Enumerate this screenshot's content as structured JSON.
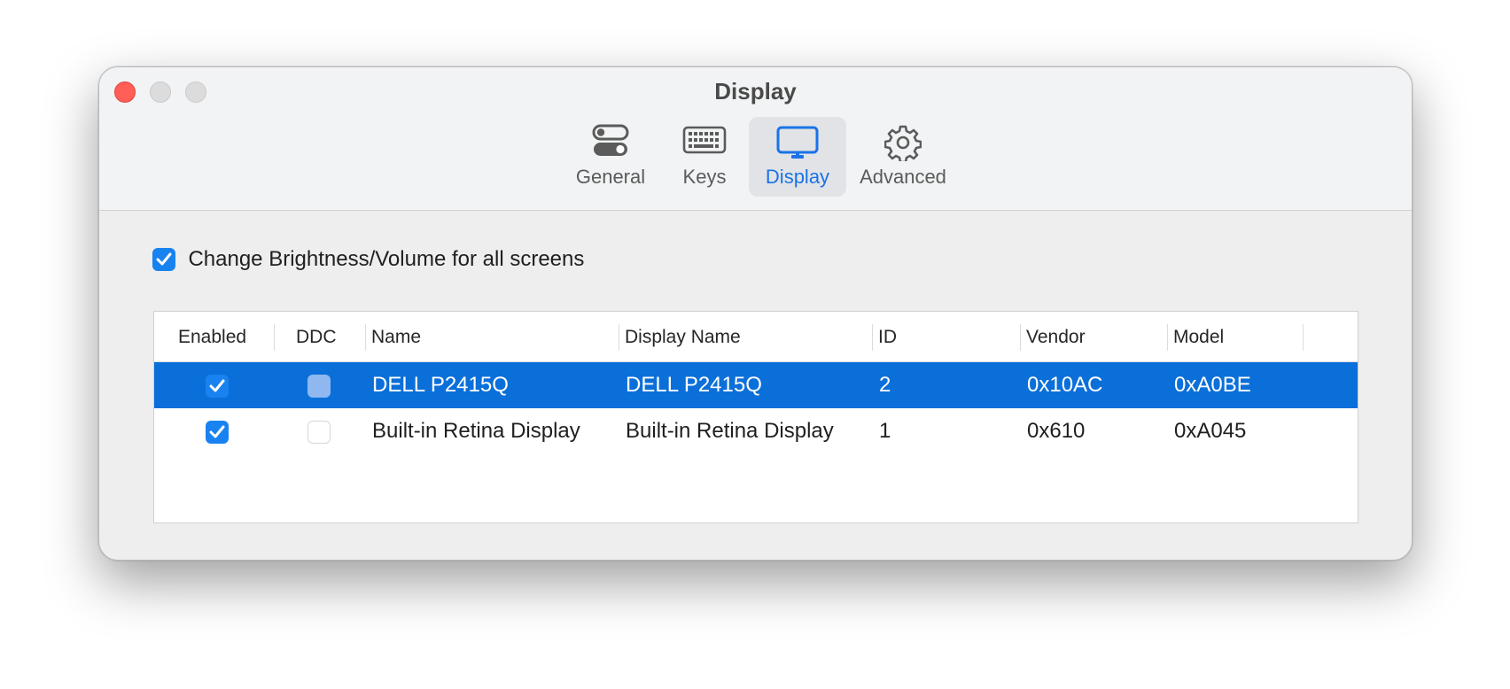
{
  "window": {
    "title": "Display"
  },
  "toolbar": {
    "tabs": [
      {
        "label": "General",
        "icon": "toggle-switches-icon",
        "active": false
      },
      {
        "label": "Keys",
        "icon": "keyboard-icon",
        "active": false
      },
      {
        "label": "Display",
        "icon": "monitor-icon",
        "active": true
      },
      {
        "label": "Advanced",
        "icon": "gear-icon",
        "active": false
      }
    ]
  },
  "settings": {
    "all_screens_label": "Change Brightness/Volume for all screens",
    "all_screens_checked": true
  },
  "table": {
    "headers": [
      "Enabled",
      "DDC",
      "Name",
      "Display Name",
      "ID",
      "Vendor",
      "Model"
    ],
    "rows": [
      {
        "enabled": true,
        "ddc": "dimmed",
        "name": "DELL P2415Q",
        "display_name": "DELL P2415Q",
        "id": "2",
        "vendor": "0x10AC",
        "model": "0xA0BE",
        "selected": true
      },
      {
        "enabled": true,
        "ddc": "unchecked",
        "name": "Built-in Retina Display",
        "display_name": "Built-in Retina Display",
        "id": "1",
        "vendor": "0x610",
        "model": "0xA045",
        "selected": false
      }
    ]
  },
  "colors": {
    "accent": "#1883f0",
    "selection": "#0b6fd9",
    "close": "#ff5f57"
  }
}
